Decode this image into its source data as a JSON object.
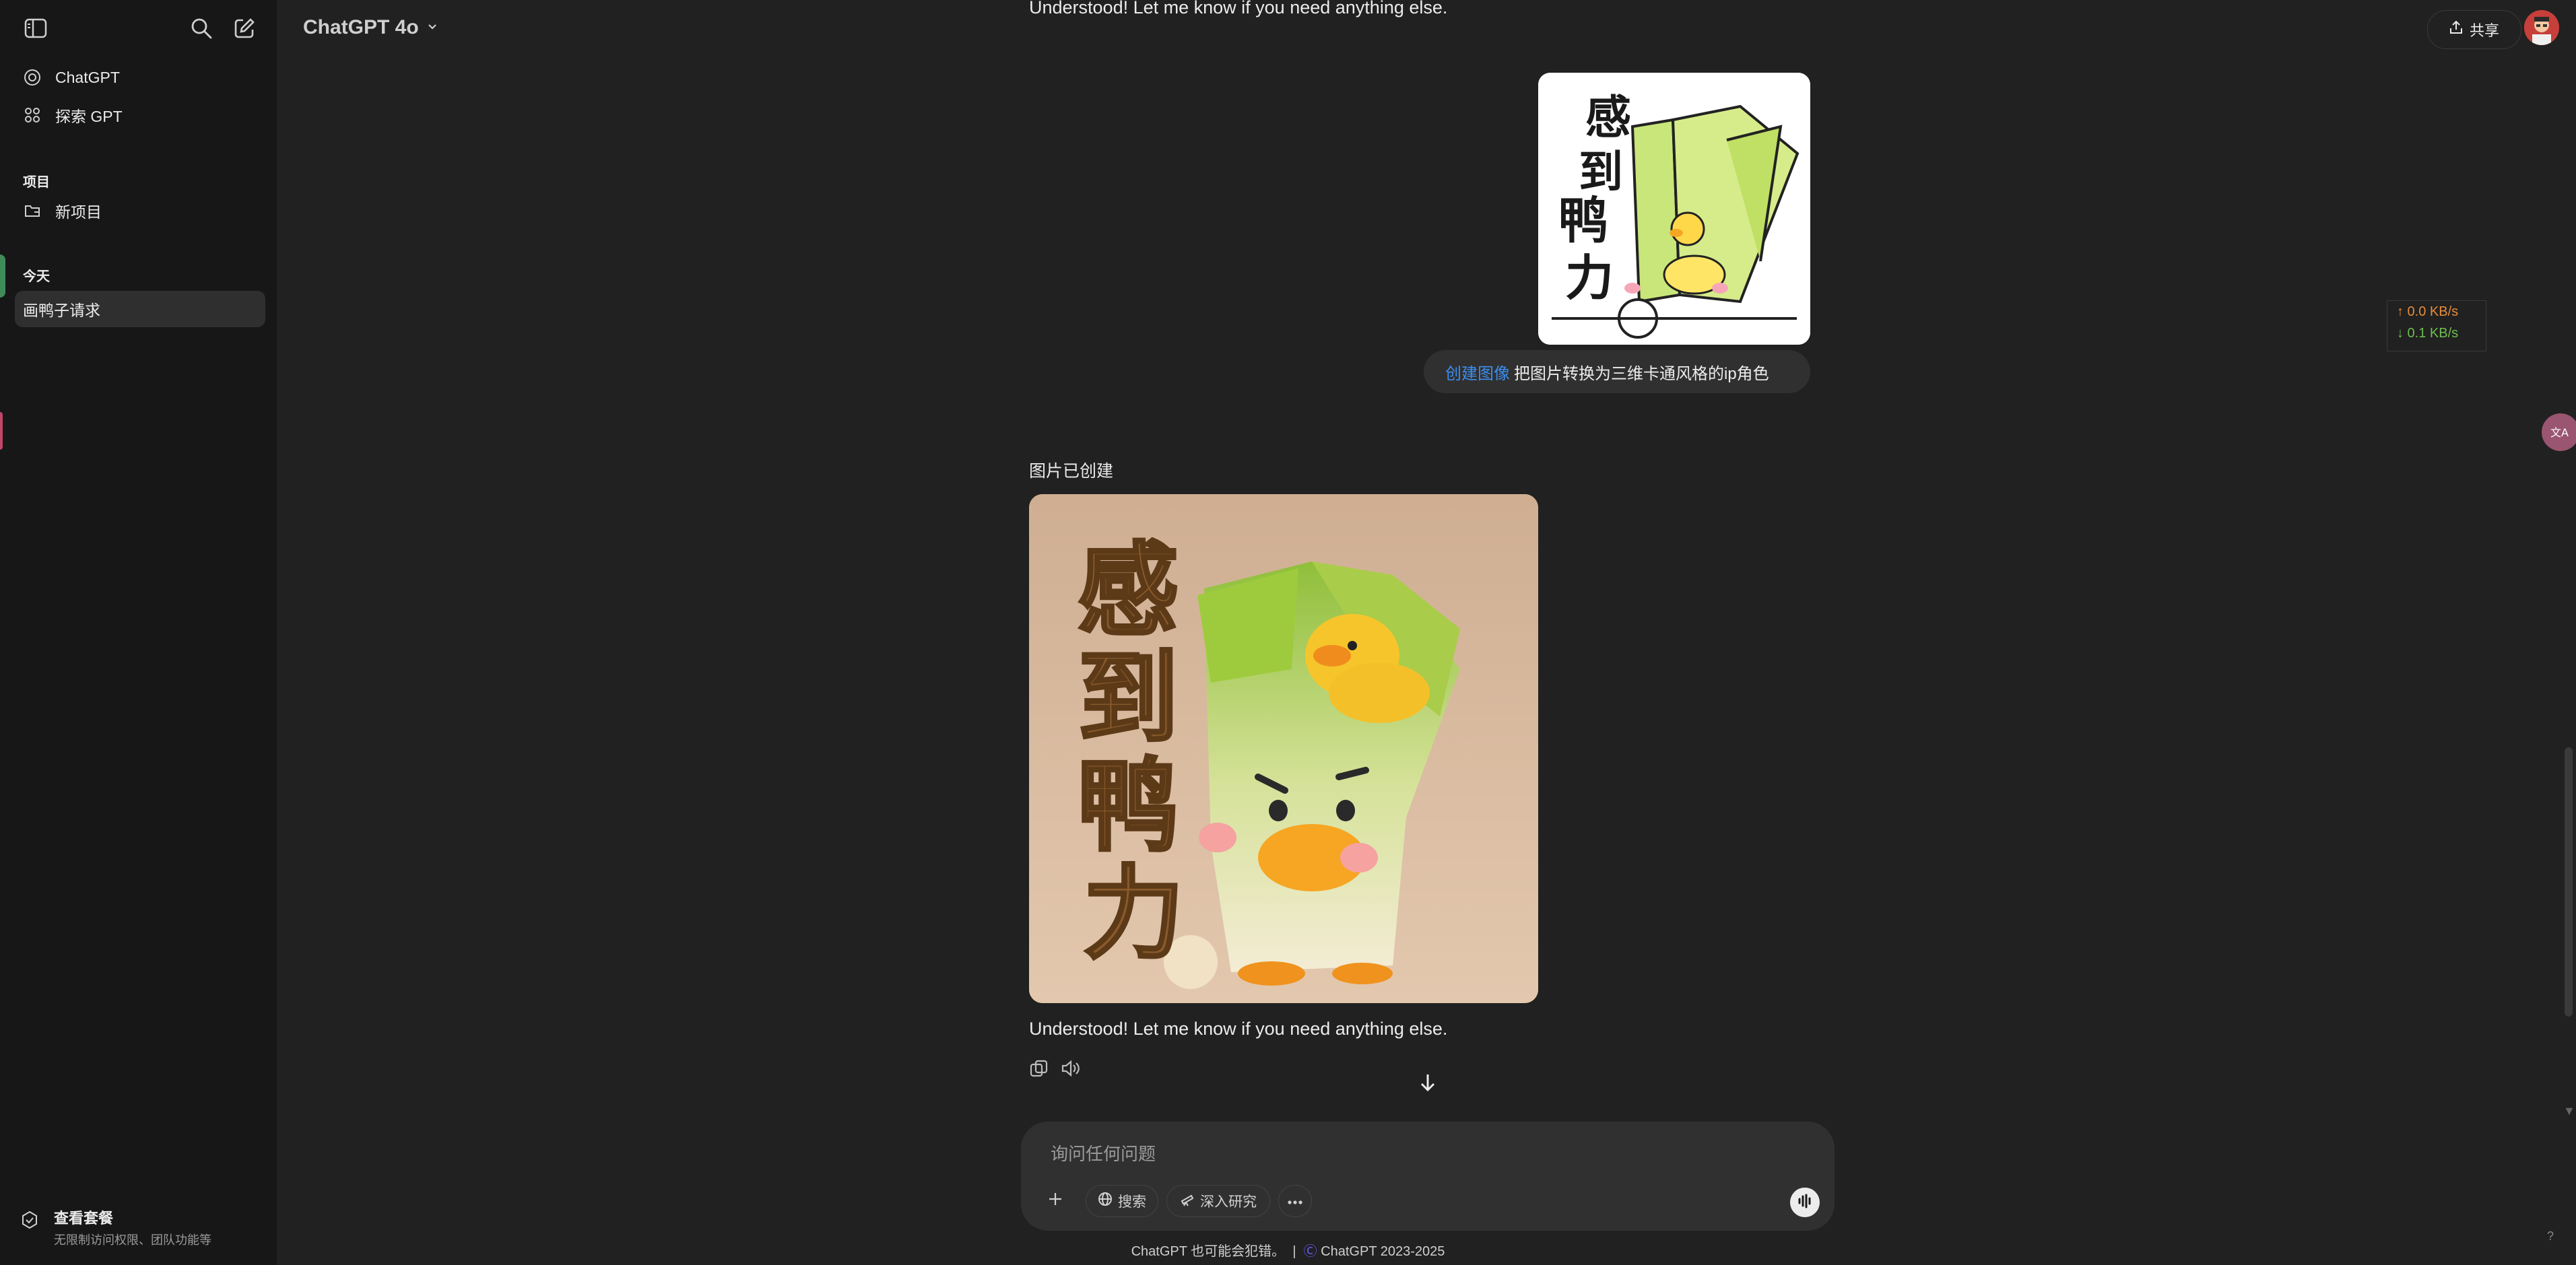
{
  "sidebar": {
    "items": [
      {
        "label": "ChatGPT",
        "icon": "openai-logo-icon"
      },
      {
        "label": "探索 GPT",
        "icon": "grid-icon"
      }
    ],
    "projects_header": "项目",
    "new_project": "新项目",
    "today_header": "今天",
    "chats": [
      "画鸭子请求"
    ],
    "plan_title": "查看套餐",
    "plan_sub": "无限制访问权限、团队功能等"
  },
  "header": {
    "model": "ChatGPT 4o",
    "share": "共享"
  },
  "chat": {
    "prev_reply": "Understood! Let me know if you need anything else.",
    "user_tag": "创建图像",
    "user_text": "把图片转换为三维卡通风格的ip角色",
    "image_created": "图片已创建",
    "reply": "Understood! Let me know if you need anything else.",
    "sticker_text": "感到鸭力"
  },
  "netspeed": {
    "up": "↑ 0.0 KB/s",
    "down": "↓ 0.1 KB/s"
  },
  "composer": {
    "placeholder": "询问任何问题",
    "search": "搜索",
    "research": "深入研究"
  },
  "footer": {
    "left": "ChatGPT 也可能会犯错。",
    "right": "ChatGPT 2023-2025"
  },
  "help": "?"
}
